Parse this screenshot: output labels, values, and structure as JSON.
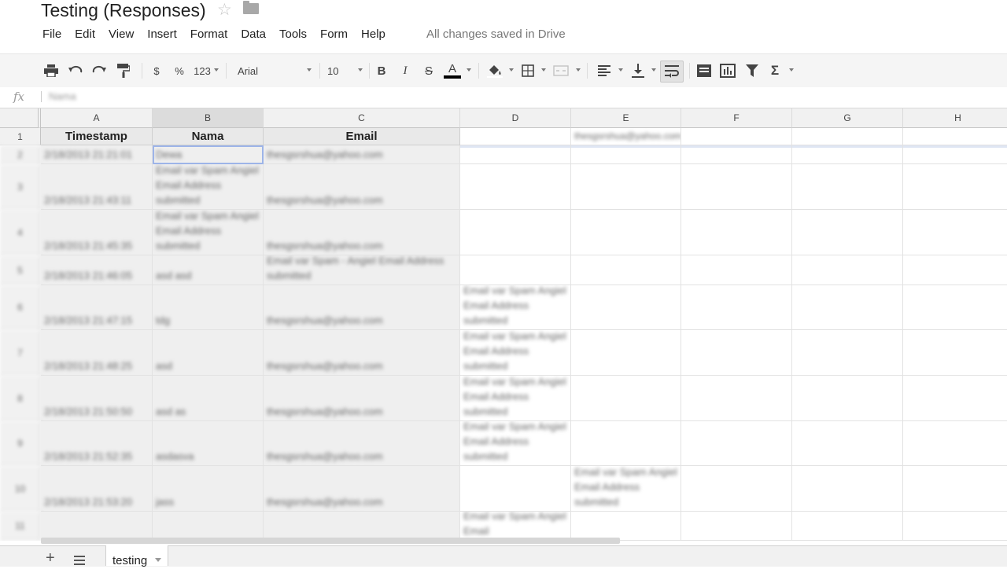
{
  "title": {
    "doc_title": "Testing (Responses)",
    "star_icon": "star-icon",
    "folder_icon": "folder-icon"
  },
  "menu": {
    "items": [
      "File",
      "Edit",
      "View",
      "Insert",
      "Format",
      "Data",
      "Tools",
      "Form",
      "Help"
    ],
    "status": "All changes saved in Drive"
  },
  "toolbar": {
    "currency": "$",
    "percent": "%",
    "number_format": "123",
    "font": "Arial",
    "font_size": "10",
    "bold": "B",
    "italic": "I",
    "strike": "S",
    "text_color_letter": "A",
    "text_color": "#000000",
    "icons": [
      "print-icon",
      "undo-icon",
      "redo-icon",
      "paint-format-icon",
      "fill-color-icon",
      "borders-icon",
      "merge-icon",
      "align-left-icon",
      "valign-bottom-icon",
      "wrap-text-icon",
      "comment-icon",
      "chart-icon",
      "filter-icon",
      "sigma-icon"
    ]
  },
  "formula_bar": {
    "fx": "fx",
    "value": "Nama"
  },
  "grid": {
    "columns": [
      "A",
      "B",
      "C",
      "D",
      "E",
      "F",
      "G",
      "H"
    ],
    "selected_column": "B",
    "header_row": {
      "row_number": "1",
      "A": "Timestamp",
      "B": "Nama",
      "C": "Email",
      "E": "thesgsrshua@yahoo.com"
    },
    "rows": [
      {
        "num": "2",
        "A": "2/18/2013 21:21:01",
        "B": "Dewa",
        "C": "thesgsrshua@yahoo.com",
        "D": "",
        "E": ""
      },
      {
        "num": "3",
        "A": "2/18/2013 21:43:11",
        "B": "Email var Spam Angiel Email Address submitted",
        "C": "thesgsrshua@yahoo.com",
        "D": "",
        "E": ""
      },
      {
        "num": "4",
        "A": "2/18/2013 21:45:35",
        "B": "Email var Spam Angiel Email Address submitted",
        "C": "thesgsrshua@yahoo.com",
        "D": "",
        "E": ""
      },
      {
        "num": "5",
        "A": "2/18/2013 21:46:05",
        "B": "asd asd",
        "C": "Email var Spam - Angiel Email Address submitted",
        "D": "",
        "E": ""
      },
      {
        "num": "6",
        "A": "2/18/2013 21:47:15",
        "B": "tdg",
        "C": "thesgsrshua@yahoo.com",
        "D": "Email var Spam Angiel Email Address submitted",
        "E": ""
      },
      {
        "num": "7",
        "A": "2/18/2013 21:48:25",
        "B": "asd",
        "C": "thesgsrshua@yahoo.com",
        "D": "Email var Spam Angiel Email Address submitted",
        "E": ""
      },
      {
        "num": "8",
        "A": "2/18/2013 21:50:50",
        "B": "asd as",
        "C": "thesgsrshua@yahoo.com",
        "D": "Email var Spam Angiel Email Address submitted",
        "E": ""
      },
      {
        "num": "9",
        "A": "2/18/2013 21:52:35",
        "B": "asdasva",
        "C": "thesgsrshua@yahoo.com",
        "D": "Email var Spam Angiel Email Address submitted",
        "E": ""
      },
      {
        "num": "10",
        "A": "2/18/2013 21:53:20",
        "B": "jass",
        "C": "thesgsrshua@yahoo.com",
        "D": "",
        "E": "Email var Spam Angiel Email Address submitted"
      },
      {
        "num": "11",
        "A": "",
        "B": "",
        "C": "",
        "D": "Email var Spam Angiel Email",
        "E": ""
      }
    ]
  },
  "sheets": {
    "add_icon": "+",
    "active_sheet": "testing"
  }
}
